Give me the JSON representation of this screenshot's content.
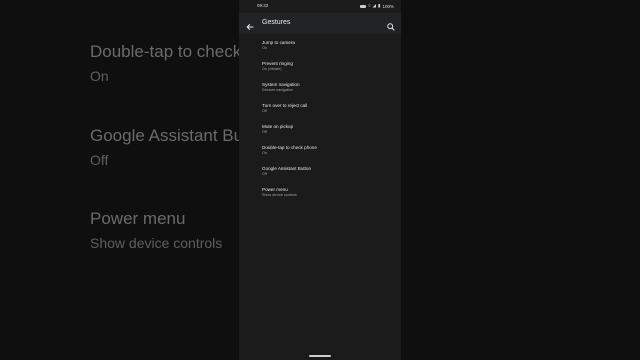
{
  "background": {
    "items": [
      {
        "title": "Double-tap to check",
        "subtitle": "On"
      },
      {
        "title": "Google Assistant But",
        "subtitle": "Off"
      },
      {
        "title": "Power menu",
        "subtitle": "Show device controls"
      }
    ]
  },
  "status_bar": {
    "time": "09:32",
    "battery": "100%"
  },
  "app_bar": {
    "title": "Gestures"
  },
  "settings": [
    {
      "title": "Jump to camera",
      "subtitle": "On"
    },
    {
      "title": "Prevent ringing",
      "subtitle": "On (vibrate)"
    },
    {
      "title": "System navigation",
      "subtitle": "Gesture navigation"
    },
    {
      "title": "Turn over to reject call",
      "subtitle": "Off"
    },
    {
      "title": "Mute on pickup",
      "subtitle": "Off"
    },
    {
      "title": "Double-tap to check phone",
      "subtitle": "On"
    },
    {
      "title": "Google Assistant Button",
      "subtitle": "Off"
    },
    {
      "title": "Power menu",
      "subtitle": "Show device controls"
    }
  ],
  "colors": {
    "background": "#1b1b1b",
    "app_bar": "#222325",
    "text_primary": "#e6e6e6",
    "text_secondary": "#a3a3a3"
  },
  "icons": {
    "back": "arrow-left-icon",
    "search": "search-icon"
  }
}
